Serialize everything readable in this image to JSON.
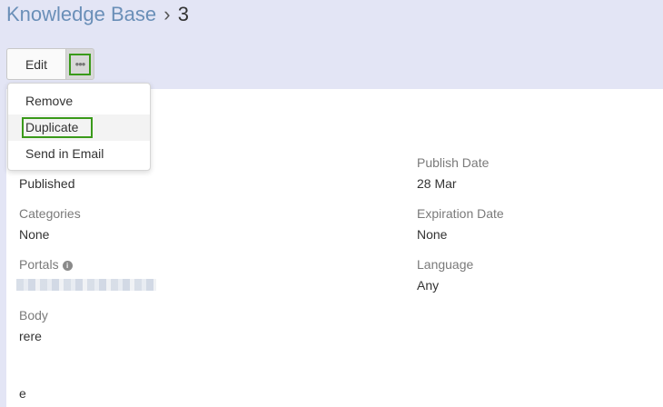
{
  "breadcrumb": {
    "parent": "Knowledge Base",
    "separator": "›",
    "current": "3"
  },
  "toolbar": {
    "edit_label": "Edit",
    "more_glyph": "•••"
  },
  "dropdown": {
    "items": [
      "Remove",
      "Duplicate",
      "Send in Email"
    ],
    "highlighted": "Duplicate"
  },
  "fields": {
    "status": {
      "value": "Published"
    },
    "publish_date": {
      "label": "Publish Date",
      "value": "28 Mar"
    },
    "categories": {
      "label": "Categories",
      "value": "None"
    },
    "expiration_date": {
      "label": "Expiration Date",
      "value": "None"
    },
    "portals": {
      "label": "Portals",
      "info_glyph": "i"
    },
    "language": {
      "label": "Language",
      "value": "Any"
    },
    "body": {
      "label": "Body",
      "value": "rere"
    },
    "extra": {
      "value": "e"
    }
  },
  "colors": {
    "accent_outline": "#3a9a1a",
    "link": "#6a8fb8",
    "header_bg": "#e3e5f5"
  }
}
